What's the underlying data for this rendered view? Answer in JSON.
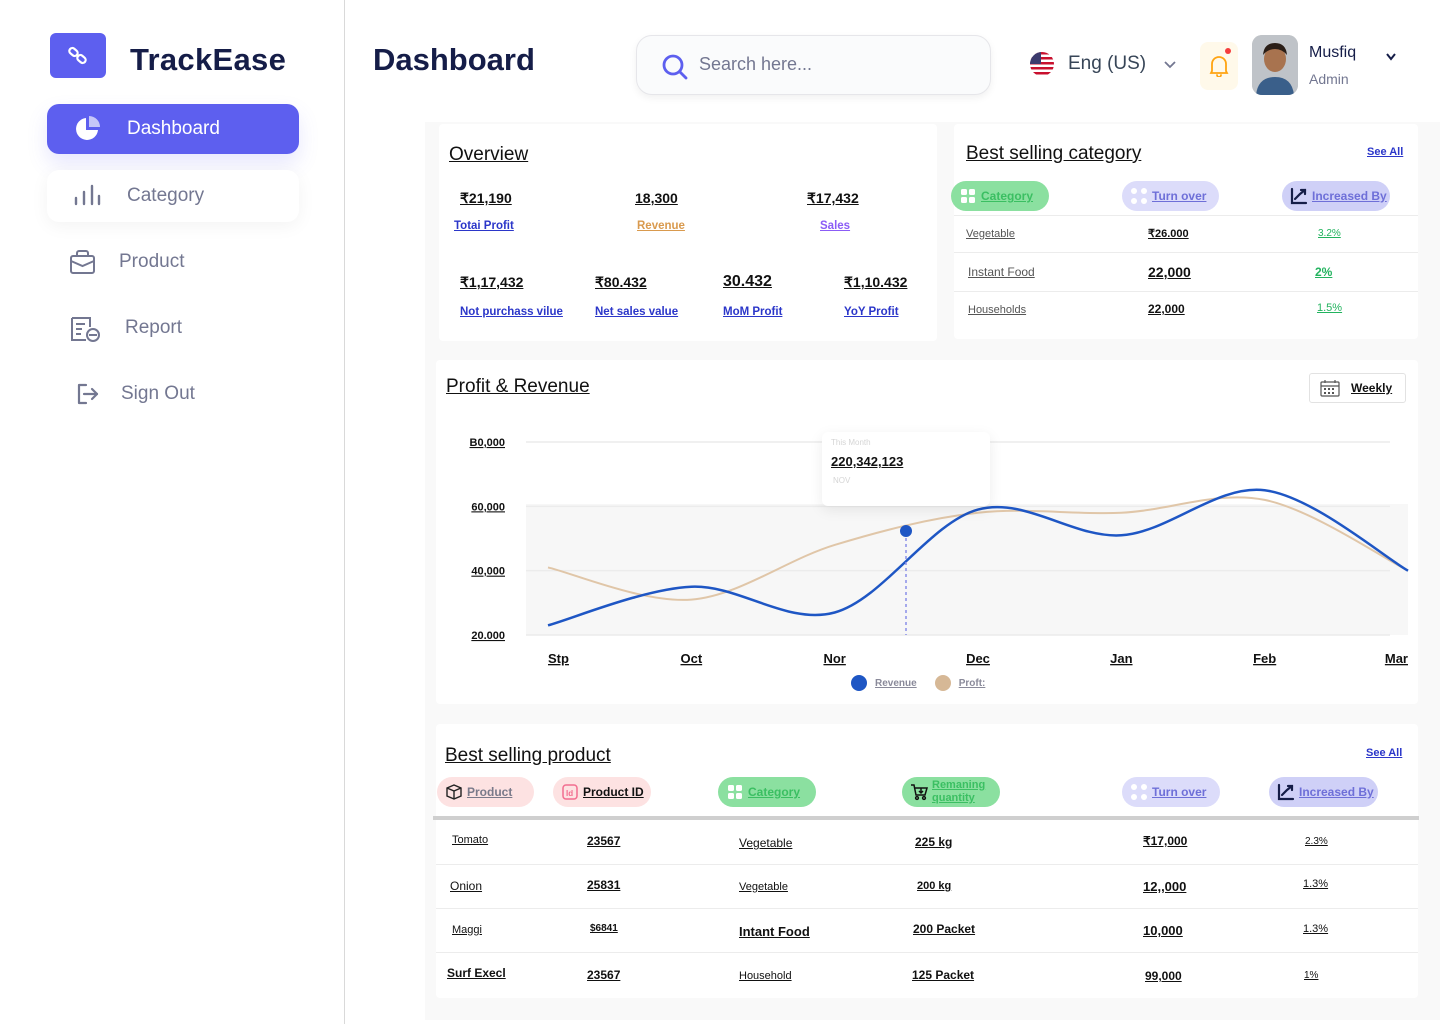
{
  "app": {
    "name": "TrackEase"
  },
  "sidebar": {
    "items": [
      {
        "label": "Dashboard",
        "icon": "pie-chart-icon",
        "active": true
      },
      {
        "label": "Category",
        "icon": "bar-chart-icon"
      },
      {
        "label": "Product",
        "icon": "shopping-bag-icon"
      },
      {
        "label": "Report",
        "icon": "report-icon"
      },
      {
        "label": "Sign Out",
        "icon": "sign-out-icon"
      }
    ]
  },
  "header": {
    "title": "Dashboard",
    "search_placeholder": "Search here...",
    "language": "Eng (US)",
    "user": {
      "name": "Musfiq",
      "role": "Admin"
    }
  },
  "overview": {
    "title": "Overview",
    "stats": [
      {
        "value": "₹21,190",
        "label": "Totai Profit",
        "color": "#2b36c9"
      },
      {
        "value": "18,300",
        "label": "Revenue",
        "color": "#d99a4e"
      },
      {
        "value": "₹17,432",
        "label": "Sales",
        "color": "#8b5cf6"
      },
      {
        "value": "₹1,17,432",
        "label": "Not purchass vilue",
        "color": "#2b36c9"
      },
      {
        "value": "₹80.432",
        "label": "Net sales value",
        "color": "#2b36c9"
      },
      {
        "value": "30.432",
        "label": "MoM Profit",
        "color": "#2b36c9"
      },
      {
        "value": "₹1,10.432",
        "label": "YoY Profit",
        "color": "#2b36c9"
      }
    ]
  },
  "best_category": {
    "title": "Best selling category",
    "see_all": "See All",
    "headers": [
      "Category",
      "Turn over",
      "Increased By"
    ],
    "rows": [
      {
        "category": "Vegetable",
        "turnover": "₹26.000",
        "increase": "3.2%"
      },
      {
        "category": "Instant Food",
        "turnover": "22,000",
        "increase": "2%"
      },
      {
        "category": "Households",
        "turnover": "22,000",
        "increase": "1.5%"
      }
    ]
  },
  "profit_revenue": {
    "title": "Profit & Revenue",
    "period": "Weekly",
    "tooltip": {
      "caption": "This Month",
      "value": "220,342,123",
      "sub": "NOV"
    },
    "legend": [
      "Revenue",
      "Proft:"
    ]
  },
  "chart_data": {
    "type": "line",
    "categories": [
      "Stp",
      "Oct",
      "Nor",
      "Dec",
      "Jan",
      "Feb",
      "Mar"
    ],
    "y_ticks": [
      "B0,000",
      "60,000",
      "40,000",
      "20.000"
    ],
    "ylim": [
      20000,
      80000
    ],
    "series": [
      {
        "name": "Revenue",
        "color": "#1e56c4",
        "values": [
          23000,
          35000,
          27000,
          59000,
          51000,
          65000,
          40000
        ]
      },
      {
        "name": "Proft:",
        "color": "#e0c6a8",
        "values": [
          41000,
          31000,
          48000,
          58000,
          58000,
          62000,
          40000
        ]
      }
    ]
  },
  "best_product": {
    "title": "Best selling product",
    "see_all": "See All",
    "headers": [
      "Product",
      "Product ID",
      "Category",
      "Remaning quantity",
      "Turn over",
      "Increased By"
    ],
    "rows": [
      {
        "product": "Tomato",
        "id": "23567",
        "category": "Vegetable",
        "qty": "225 kg",
        "turnover": "₹17,000",
        "increase": "2.3%"
      },
      {
        "product": "Onion",
        "id": "25831",
        "category": "Vegetable",
        "qty": "200 kg",
        "turnover": "12,,000",
        "increase": "1.3%"
      },
      {
        "product": "Maggi",
        "id": "$6841",
        "category": "Intant Food",
        "qty": "200 Packet",
        "turnover": "10,000",
        "increase": "1.3%"
      },
      {
        "product": "Surf Execl",
        "id": "23567",
        "category": "Household",
        "qty": "125 Packet",
        "turnover": "99,000",
        "increase": "1%"
      }
    ]
  },
  "colors": {
    "accent": "#5d5fef",
    "sidebar_text": "#737791",
    "link": "#2b36c9",
    "green": "#22b35e"
  }
}
